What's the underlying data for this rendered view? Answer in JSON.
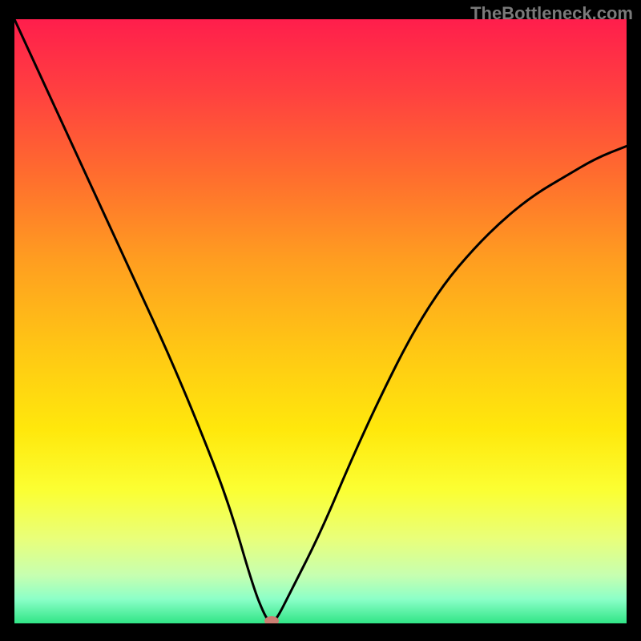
{
  "watermark": "TheBottleneck.com",
  "chart_data": {
    "type": "line",
    "title": "",
    "xlabel": "",
    "ylabel": "",
    "xlim": [
      0,
      100
    ],
    "ylim": [
      0,
      100
    ],
    "series": [
      {
        "name": "bottleneck-curve",
        "x": [
          0,
          5,
          10,
          15,
          20,
          25,
          30,
          35,
          39,
          41,
          42,
          43,
          45,
          50,
          55,
          60,
          65,
          70,
          75,
          80,
          85,
          90,
          95,
          100
        ],
        "values": [
          100,
          89,
          78,
          67,
          56,
          45,
          33,
          20,
          6,
          1,
          0,
          1,
          5,
          15,
          27,
          38,
          48,
          56,
          62,
          67,
          71,
          74,
          77,
          79
        ]
      }
    ],
    "minimum_point": {
      "x": 42,
      "y": 0
    },
    "gradient_stops": [
      {
        "pct": 0,
        "color": "#ff1e4c"
      },
      {
        "pct": 12,
        "color": "#ff4040"
      },
      {
        "pct": 25,
        "color": "#ff6a2f"
      },
      {
        "pct": 40,
        "color": "#ff9e20"
      },
      {
        "pct": 55,
        "color": "#ffc814"
      },
      {
        "pct": 68,
        "color": "#ffe80c"
      },
      {
        "pct": 78,
        "color": "#fbff33"
      },
      {
        "pct": 86,
        "color": "#e9ff7a"
      },
      {
        "pct": 92,
        "color": "#c7ffb0"
      },
      {
        "pct": 96,
        "color": "#8bffc8"
      },
      {
        "pct": 100,
        "color": "#30e586"
      }
    ]
  }
}
